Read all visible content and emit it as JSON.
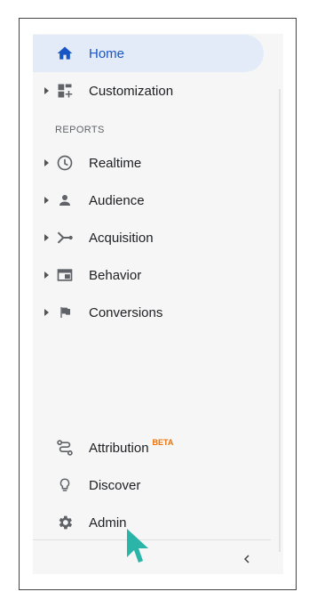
{
  "nav": {
    "home": {
      "label": "Home",
      "icon": "home-icon"
    },
    "customization": {
      "label": "Customization",
      "icon": "dashboard-plus-icon"
    },
    "section_reports": "REPORTS",
    "realtime": {
      "label": "Realtime",
      "icon": "clock-icon"
    },
    "audience": {
      "label": "Audience",
      "icon": "person-icon"
    },
    "acquisition": {
      "label": "Acquisition",
      "icon": "merge-arrow-icon"
    },
    "behavior": {
      "label": "Behavior",
      "icon": "window-icon"
    },
    "conversions": {
      "label": "Conversions",
      "icon": "flag-icon"
    },
    "attribution": {
      "label": "Attribution",
      "badge": "BETA",
      "icon": "attribution-path-icon"
    },
    "discover": {
      "label": "Discover",
      "icon": "lightbulb-icon"
    },
    "admin": {
      "label": "Admin",
      "icon": "gear-icon"
    }
  },
  "footer": {
    "collapse_icon": "chevron-left-icon"
  },
  "colors": {
    "active_bg": "#e3ebf9",
    "active_text": "#1a55c4",
    "badge": "#e8710a",
    "cursor": "#2bb5a8"
  }
}
